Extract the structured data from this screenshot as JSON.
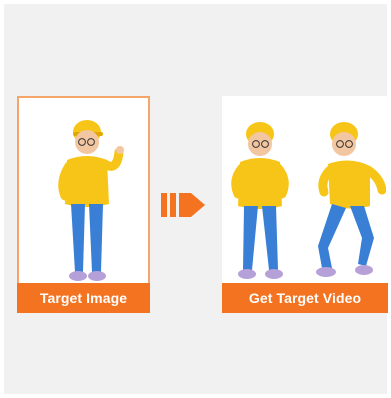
{
  "panels": {
    "target": {
      "label": "Target Image"
    },
    "result": {
      "label": "Get Target Video"
    }
  },
  "icons": {
    "arrow": "arrow-right-icon"
  },
  "colors": {
    "accent": "#f47321",
    "border": "#f5a56a",
    "hoodie": "#f7c518",
    "jeans": "#3a7fd6",
    "background": "#f1f1f1"
  }
}
